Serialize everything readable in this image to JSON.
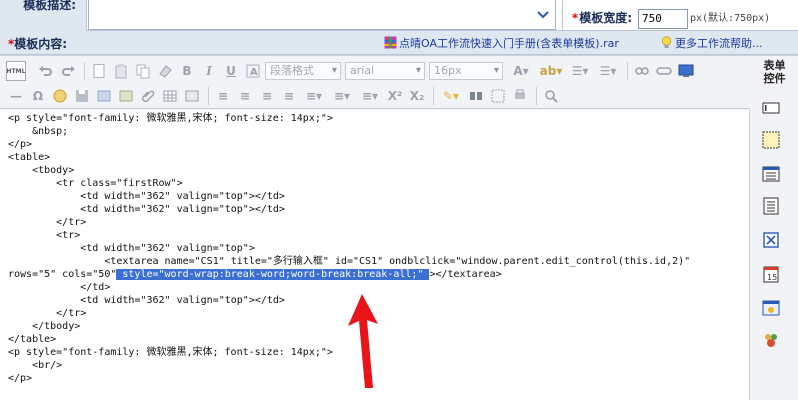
{
  "form": {
    "desc_label": "模板描述:",
    "width_label": "模板宽度:",
    "width_value": "750",
    "width_hint": "px(默认:750px)",
    "content_label": "模板内容:",
    "required_mark": "*"
  },
  "links": {
    "manual": "点晴OA工作流快速入门手册(含表单模板).rar",
    "more_help": "更多工作流帮助..."
  },
  "toolbar": {
    "html_label": "HTML",
    "paragraph_format": "段落格式",
    "font_family": "arial",
    "font_size": "16px"
  },
  "side_panel": {
    "title_line1": "表单",
    "title_line2": "控件"
  },
  "code": {
    "lines": [
      "<p style=\"font-family: 微软雅黑,宋体; font-size: 14px;\">",
      "    &nbsp;",
      "</p>",
      "<table>",
      "    <tbody>",
      "        <tr class=\"firstRow\">",
      "            <td width=\"362\" valign=\"top\"></td>",
      "            <td width=\"362\" valign=\"top\"></td>",
      "        </tr>",
      "        <tr>",
      "            <td width=\"362\" valign=\"top\">",
      "                <textarea name=\"CS1\" title=\"多行输入框\" id=\"CS1\" ondblclick=\"window.parent.edit_control(this.id,2)\"",
      "rows=\"5\" cols=\"50\"",
      "            </td>",
      "            <td width=\"362\" valign=\"top\"></td>",
      "        </tr>",
      "    </tbody>",
      "</table>",
      "<p style=\"font-family: 微软雅黑,宋体; font-size: 14px;\">",
      "    <br/>",
      "</p>"
    ],
    "highlight": " style=\"word-wrap:break-word;word-break:break-all;\" ",
    "after_highlight": "></textarea>"
  },
  "colors": {
    "header_bg": "#dfe7f1",
    "label_text": "#1a2f55",
    "required": "#dd0000",
    "link": "#1a3c9c",
    "selection": "#3b6fd1",
    "arrow": "#e8141a"
  }
}
